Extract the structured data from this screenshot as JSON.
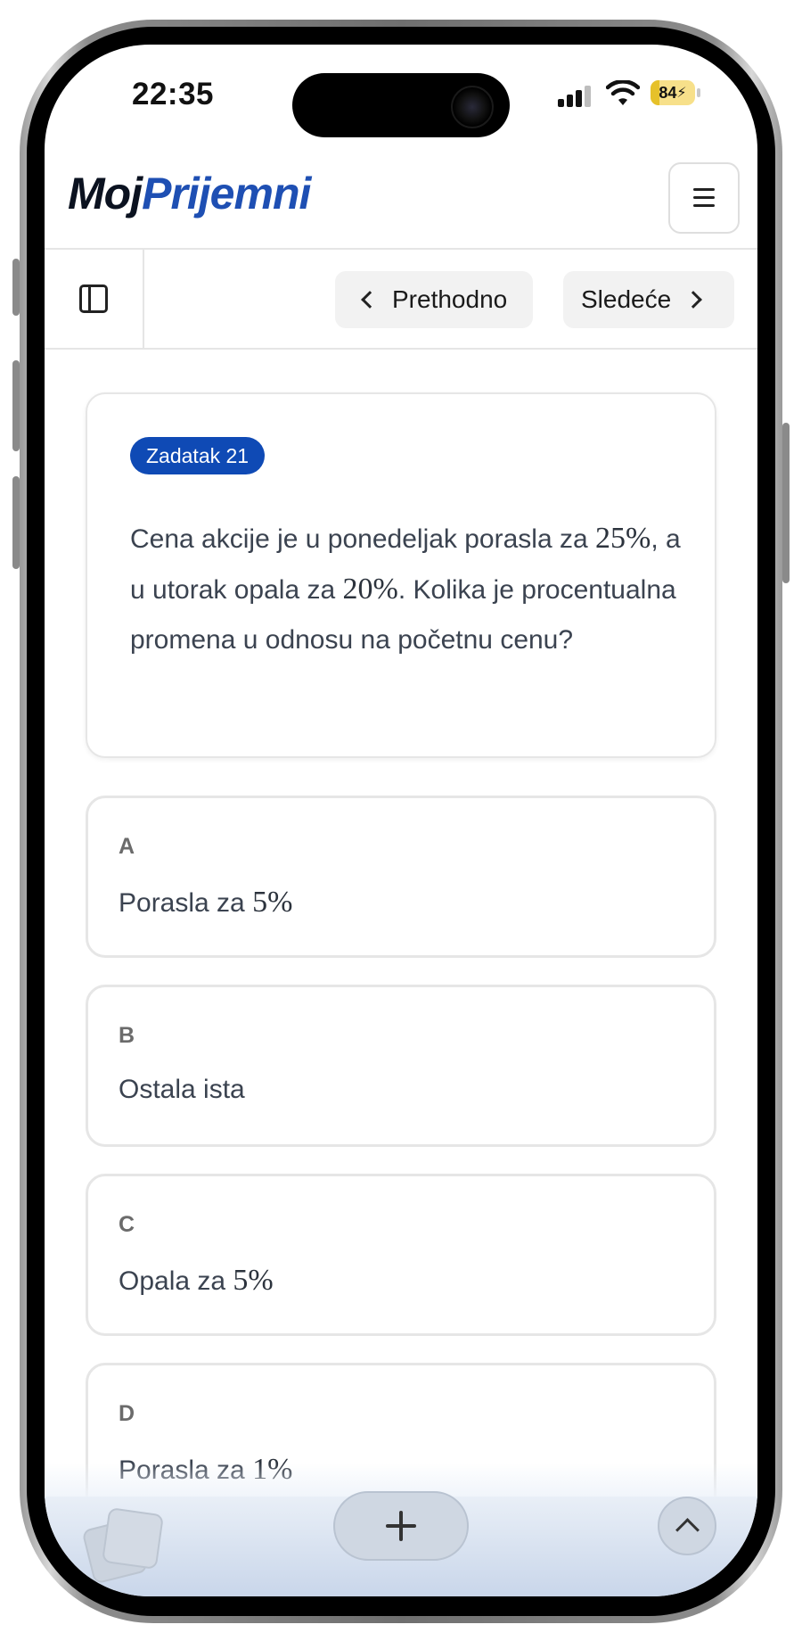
{
  "status_bar": {
    "time": "22:35",
    "battery": "84"
  },
  "header": {
    "logo_part1": "Moj",
    "logo_part2": "Prijemni",
    "menu_icon": "hamburger-icon"
  },
  "toolbar": {
    "sidebar_icon": "sidebar-icon",
    "prev_label": "Prethodno",
    "next_label": "Sledeće"
  },
  "question": {
    "badge": "Zadatak 21",
    "text_1": "Cena akcije je u ponedeljak porasla za",
    "math_1": "25%",
    "text_2": ", a u utorak opala za",
    "math_2": "20%",
    "text_3": ". Kolika je procentualna promena u odnosu na početnu cenu?"
  },
  "options": [
    {
      "letter": "A",
      "text": "Porasla za",
      "math": "5%"
    },
    {
      "letter": "B",
      "text": "Ostala ista",
      "math": ""
    },
    {
      "letter": "C",
      "text": "Opala za",
      "math": "5%"
    },
    {
      "letter": "D",
      "text": "Porasla za",
      "math": "1%"
    }
  ],
  "browser_bar": {
    "tabs_icon": "tabs-icon",
    "new_tab_icon": "plus-icon",
    "scroll_up_icon": "chevron-up-icon"
  },
  "colors": {
    "brand_dark": "#0b1220",
    "brand_blue": "#1e4fb3",
    "badge_bg": "#0f4ab5"
  }
}
